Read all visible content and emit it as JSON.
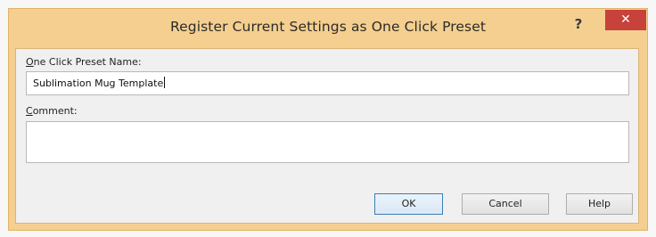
{
  "window": {
    "title": "Register Current Settings as One Click Preset",
    "help_glyph": "?",
    "close_glyph": "✕"
  },
  "form": {
    "preset_name_label_mnemonic": "O",
    "preset_name_label_rest": "ne Click Preset Name:",
    "preset_name_value": "Sublimation Mug Template",
    "comment_label_mnemonic": "C",
    "comment_label_rest": "omment:",
    "comment_value": ""
  },
  "buttons": {
    "ok_label": "OK",
    "cancel_label": "Cancel",
    "help_label": "Help"
  },
  "colors": {
    "titlebar": "#f5cf8f",
    "close_button": "#c7423b",
    "dialog_body": "#f0f0f0"
  }
}
